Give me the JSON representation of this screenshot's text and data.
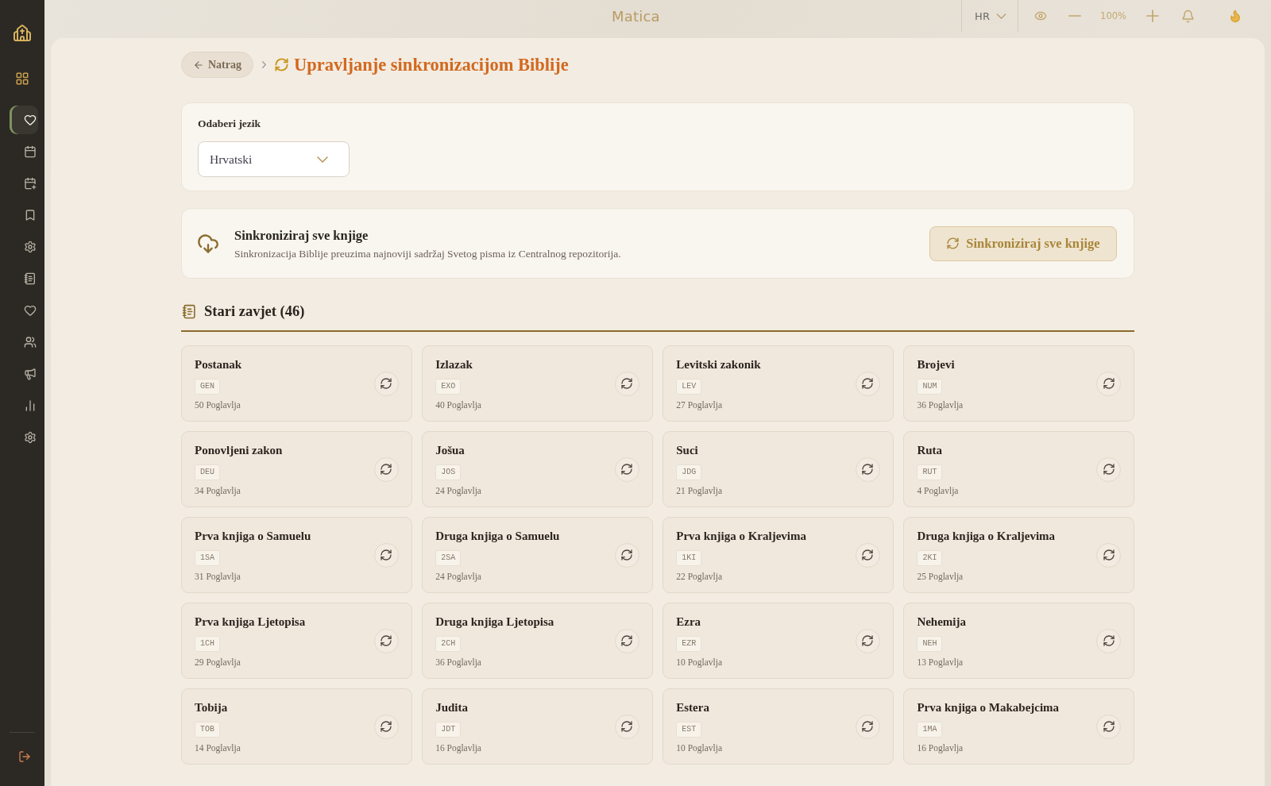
{
  "sidebar": {
    "items": [
      {
        "selected": true
      },
      {
        "selected": false
      },
      {
        "selected": false
      },
      {
        "selected": false
      },
      {
        "selected": false
      },
      {
        "selected": false
      },
      {
        "selected": false
      },
      {
        "selected": false
      },
      {
        "selected": false
      },
      {
        "selected": false
      },
      {
        "selected": false
      }
    ]
  },
  "top_bar": {
    "title": "Matica",
    "language": "HR",
    "zoom": "100%"
  },
  "header": {
    "back": "Natrag",
    "title": "Upravljanje sinkronizacijom Biblije"
  },
  "language_card": {
    "label": "Odaberi jezik",
    "value": "Hrvatski"
  },
  "sync_card": {
    "title": "Sinkroniziraj sve knjige",
    "description": "Sinkronizacija Biblije preuzima najnoviji sadržaj Svetog pisma iz Centralnog repozitorija.",
    "button": "Sinkroniziraj sve knjige"
  },
  "section": {
    "title": "Stari zavjet (46)",
    "books": [
      {
        "name": "Postanak",
        "code": "GEN",
        "chapters": "50 Poglavlja"
      },
      {
        "name": "Izlazak",
        "code": "EXO",
        "chapters": "40 Poglavlja"
      },
      {
        "name": "Levitski zakonik",
        "code": "LEV",
        "chapters": "27 Poglavlja"
      },
      {
        "name": "Brojevi",
        "code": "NUM",
        "chapters": "36 Poglavlja"
      },
      {
        "name": "Ponovljeni zakon",
        "code": "DEU",
        "chapters": "34 Poglavlja"
      },
      {
        "name": "Jošua",
        "code": "JOS",
        "chapters": "24 Poglavlja"
      },
      {
        "name": "Suci",
        "code": "JDG",
        "chapters": "21 Poglavlja"
      },
      {
        "name": "Ruta",
        "code": "RUT",
        "chapters": "4 Poglavlja"
      },
      {
        "name": "Prva knjiga o Samuelu",
        "code": "1SA",
        "chapters": "31 Poglavlja"
      },
      {
        "name": "Druga knjiga o Samuelu",
        "code": "2SA",
        "chapters": "24 Poglavlja"
      },
      {
        "name": "Prva knjiga o Kraljevima",
        "code": "1KI",
        "chapters": "22 Poglavlja"
      },
      {
        "name": "Druga knjiga o Kraljevima",
        "code": "2KI",
        "chapters": "25 Poglavlja"
      },
      {
        "name": "Prva knjiga Ljetopisa",
        "code": "1CH",
        "chapters": "29 Poglavlja"
      },
      {
        "name": "Druga knjiga Ljetopisa",
        "code": "2CH",
        "chapters": "36 Poglavlja"
      },
      {
        "name": "Ezra",
        "code": "EZR",
        "chapters": "10 Poglavlja"
      },
      {
        "name": "Nehemija",
        "code": "NEH",
        "chapters": "13 Poglavlja"
      },
      {
        "name": "Tobija",
        "code": "TOB",
        "chapters": "14 Poglavlja"
      },
      {
        "name": "Judita",
        "code": "JDT",
        "chapters": "16 Poglavlja"
      },
      {
        "name": "Estera",
        "code": "EST",
        "chapters": "10 Poglavlja"
      },
      {
        "name": "Prva knjiga o Makabejcima",
        "code": "1MA",
        "chapters": "16 Poglavlja"
      }
    ]
  }
}
